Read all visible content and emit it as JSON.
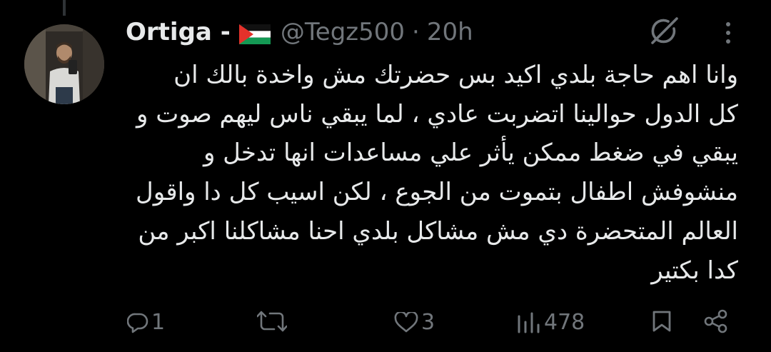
{
  "tweet": {
    "author_name": "Ortiga -",
    "handle": "@Tegz500",
    "separator": "·",
    "time": "20h",
    "lines": [
      "وانا اهم حاجة بلدي اكيد بس حضرتك مش واخدة بالك ان",
      "كل الدول حوالينا اتضربت عادي ، لما يبقي ناس ليهم صوت و",
      "يبقي في ضغط ممكن يأثر علي مساعدات انها تدخل و",
      "منشوفش اطفال بتموت من الجوع ، لكن اسيب كل دا واقول",
      "العالم المتحضرة دي مش مشاكل بلدي احنا مشاكلنا اكبر من",
      "كدا بكتير"
    ]
  },
  "actions": {
    "reply_count": "1",
    "repost_count": "",
    "like_count": "3",
    "views_count": "478"
  },
  "icons": {
    "flag": "palestine-flag",
    "grok": "grok-icon",
    "more": "more-vertical-icon",
    "reply": "reply-icon",
    "repost": "repost-icon",
    "like": "heart-icon",
    "views": "views-icon",
    "bookmark": "bookmark-icon",
    "share": "share-icon"
  },
  "colors": {
    "background": "#000000",
    "text": "#e7e9ea",
    "muted": "#71767b",
    "flag_red": "#e4312b",
    "flag_green": "#149954"
  }
}
